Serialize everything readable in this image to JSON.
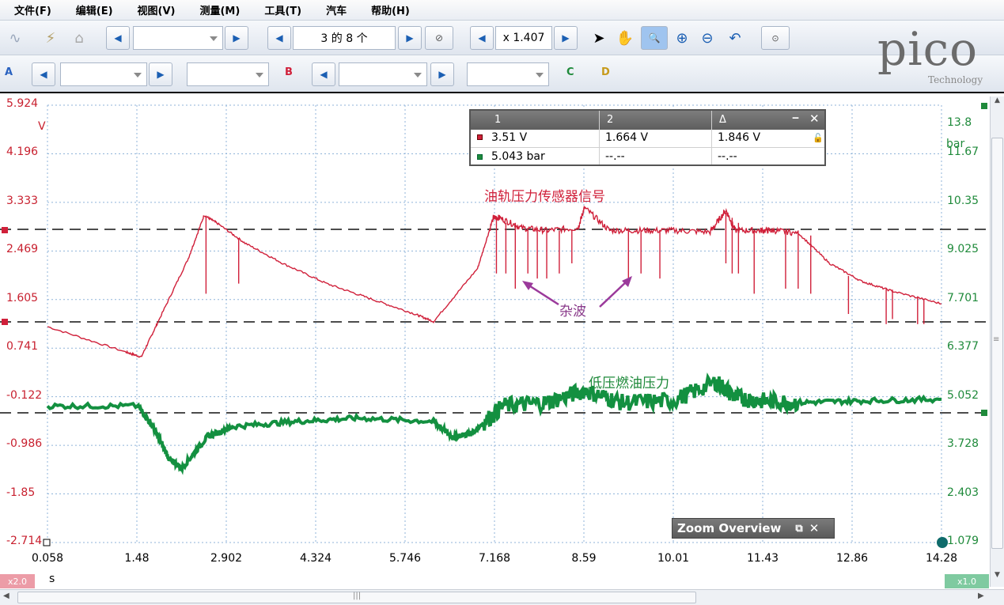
{
  "menu": [
    "文件(F)",
    "编辑(E)",
    "视图(V)",
    "测量(M)",
    "工具(T)",
    "汽车",
    "帮助(H)"
  ],
  "toolbar": {
    "page_indicator": "3 的 8 个",
    "zoom_value": "x 1.407",
    "channels": [
      "A",
      "B",
      "C",
      "D"
    ]
  },
  "logo": {
    "main": "pico",
    "sub": "Technology"
  },
  "axes": {
    "left_ticks": [
      "5.924",
      "4.196",
      "3.333",
      "2.469",
      "1.605",
      "0.741",
      "-0.122",
      "-0.986",
      "-1.85",
      "-2.714"
    ],
    "left_unit": "V",
    "right_ticks": [
      "13.8",
      "11.67",
      "10.35",
      "9.025",
      "7.701",
      "6.377",
      "5.052",
      "3.728",
      "2.403",
      "1.079"
    ],
    "right_unit": "bar",
    "x_ticks": [
      "0.058",
      "1.48",
      "2.902",
      "4.324",
      "5.746",
      "7.168",
      "8.59",
      "10.01",
      "11.43",
      "12.86",
      "14.28"
    ],
    "x_unit": "s",
    "left_zoom": "x2.0",
    "right_zoom": "x1.0"
  },
  "measurements": {
    "headers": [
      "1",
      "2",
      "Δ"
    ],
    "rows": [
      [
        "3.51 V",
        "1.664 V",
        "1.846 V"
      ],
      [
        "5.043 bar",
        "--.--",
        "--.--"
      ]
    ]
  },
  "annotations": {
    "rail_signal": "油轨压力传感器信号",
    "noise": "杂波",
    "low_pressure": "低压燃油压力"
  },
  "zoom_overview": "Zoom Overview",
  "colors": {
    "channel_a": "#d0203a",
    "channel_b": "#139040",
    "noise_arrow": "#9b3a9b"
  },
  "chart_data": {
    "type": "line",
    "x_range": [
      0.058,
      14.28
    ],
    "ylim_left": [
      -2.714,
      5.924
    ],
    "ylim_right": [
      1.079,
      13.8
    ],
    "series": [
      {
        "axis": "left",
        "x": [
          0.058,
          1.3,
          1.55,
          1.8,
          2.3,
          2.55,
          2.75,
          3.2,
          3.8,
          4.5,
          5.2,
          5.9,
          6.2,
          6.9,
          7.15,
          7.25,
          7.6,
          8.0,
          8.5,
          8.6,
          9.0,
          9.5,
          10.0,
          10.6,
          10.85,
          11.0,
          11.4,
          11.6,
          12.0,
          12.5,
          13.0,
          13.5,
          14.28
        ],
        "y": [
          1.55,
          1.05,
          0.95,
          1.6,
          2.9,
          3.75,
          3.6,
          3.2,
          2.8,
          2.4,
          2.1,
          1.8,
          1.65,
          2.7,
          3.7,
          3.7,
          3.5,
          3.45,
          3.5,
          3.9,
          3.45,
          3.45,
          3.45,
          3.42,
          3.85,
          3.45,
          3.45,
          3.45,
          3.4,
          2.8,
          2.45,
          2.25,
          2.0
        ]
      },
      {
        "axis": "right",
        "x": [
          0.058,
          1.5,
          1.75,
          2.0,
          2.2,
          2.6,
          3.0,
          4.0,
          5.0,
          6.2,
          6.5,
          6.8,
          7.3,
          8.0,
          8.6,
          9.2,
          10.0,
          10.7,
          11.0,
          11.4,
          12.0,
          13.0,
          14.28
        ],
        "y": [
          5.05,
          5.05,
          4.4,
          3.5,
          3.25,
          4.15,
          4.45,
          4.6,
          4.7,
          4.6,
          4.15,
          4.25,
          5.05,
          5.15,
          5.5,
          5.15,
          5.2,
          5.75,
          5.3,
          5.2,
          5.15,
          5.2,
          5.25
        ]
      }
    ]
  }
}
